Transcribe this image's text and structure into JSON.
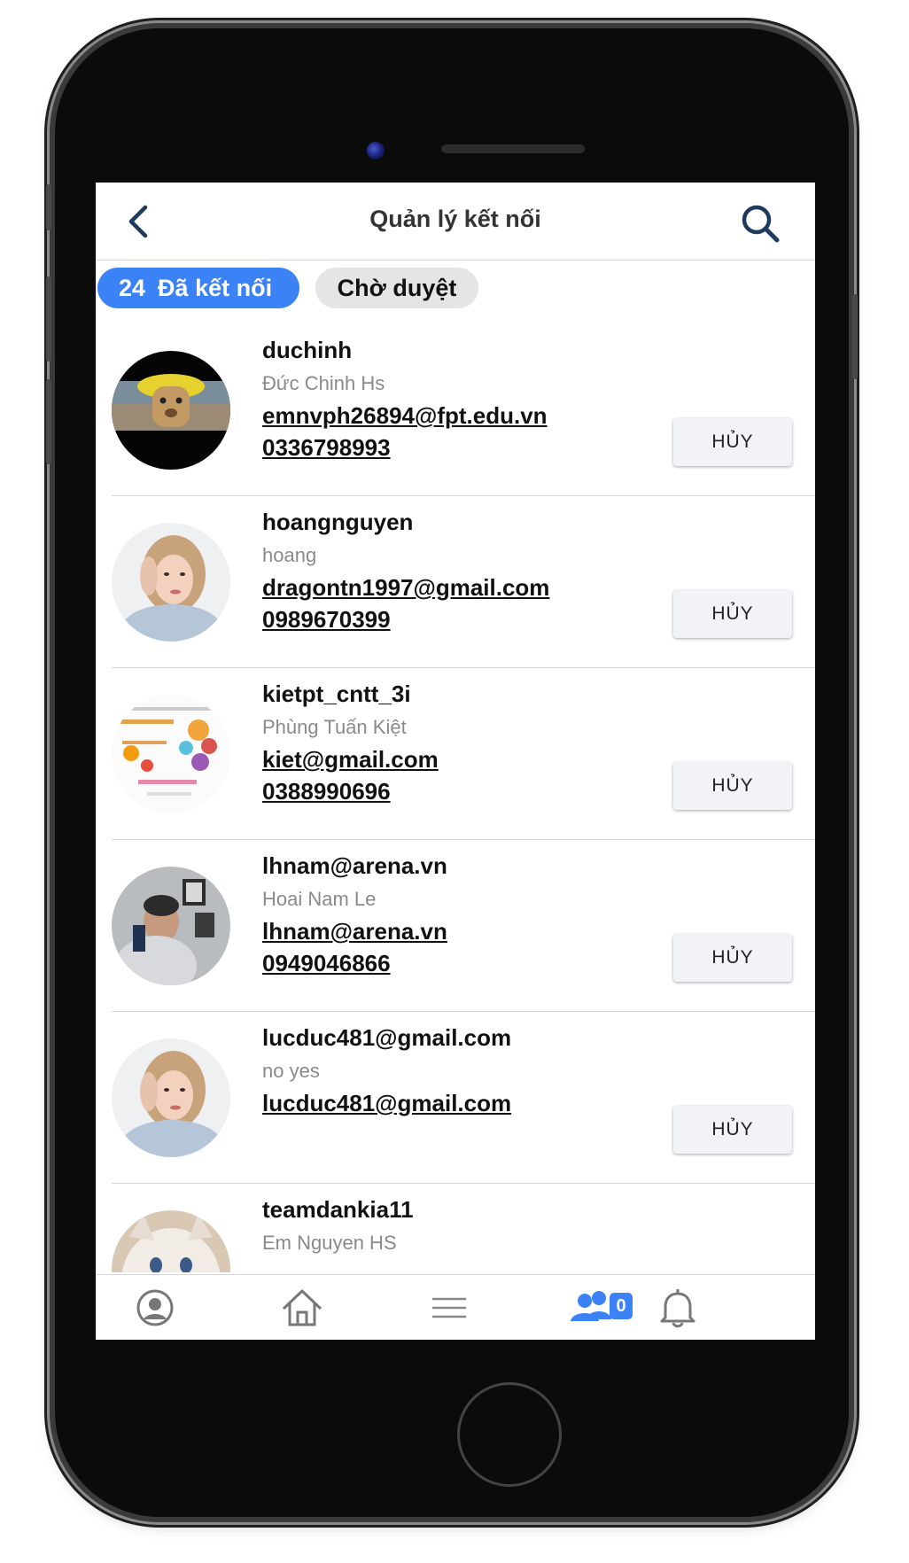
{
  "header": {
    "title": "Quản lý kết nối",
    "back_icon": "chevron-left-icon",
    "search_icon": "search-icon"
  },
  "tabs": {
    "connected": {
      "count": "24",
      "label": "Đã kết nối"
    },
    "pending": {
      "label": "Chờ duyệt"
    }
  },
  "connections": [
    {
      "username": "duchinh",
      "display_name": "Đức Chinh Hs",
      "email": "emnvph26894@fpt.edu.vn",
      "phone": "0336798993",
      "action": "HỦY"
    },
    {
      "username": "hoangnguyen",
      "display_name": "hoang",
      "email": "dragontn1997@gmail.com",
      "phone": "0989670399",
      "action": "HỦY"
    },
    {
      "username": "kietpt_cntt_3i",
      "display_name": "Phùng Tuấn Kiệt",
      "email": "kiet@gmail.com",
      "phone": "0388990696",
      "action": "HỦY"
    },
    {
      "username": "lhnam@arena.vn",
      "display_name": "Hoai Nam Le",
      "email": "lhnam@arena.vn",
      "phone": "0949046866",
      "action": "HỦY"
    },
    {
      "username": "lucduc481@gmail.com",
      "display_name": "no yes",
      "email": "lucduc481@gmail.com",
      "action": "HỦY"
    },
    {
      "username": "teamdankia11",
      "display_name": "Em Nguyen HS"
    }
  ],
  "bottom_nav": {
    "items": [
      "profile-icon",
      "home-icon",
      "menu-icon",
      "friends-icon",
      "bell-icon"
    ],
    "active": "friends-icon",
    "friends_badge": "0"
  },
  "colors": {
    "accent": "#3b82f6",
    "pending_tab_bg": "#e5e5e5",
    "cancel_button_bg": "#f2f3f6"
  }
}
